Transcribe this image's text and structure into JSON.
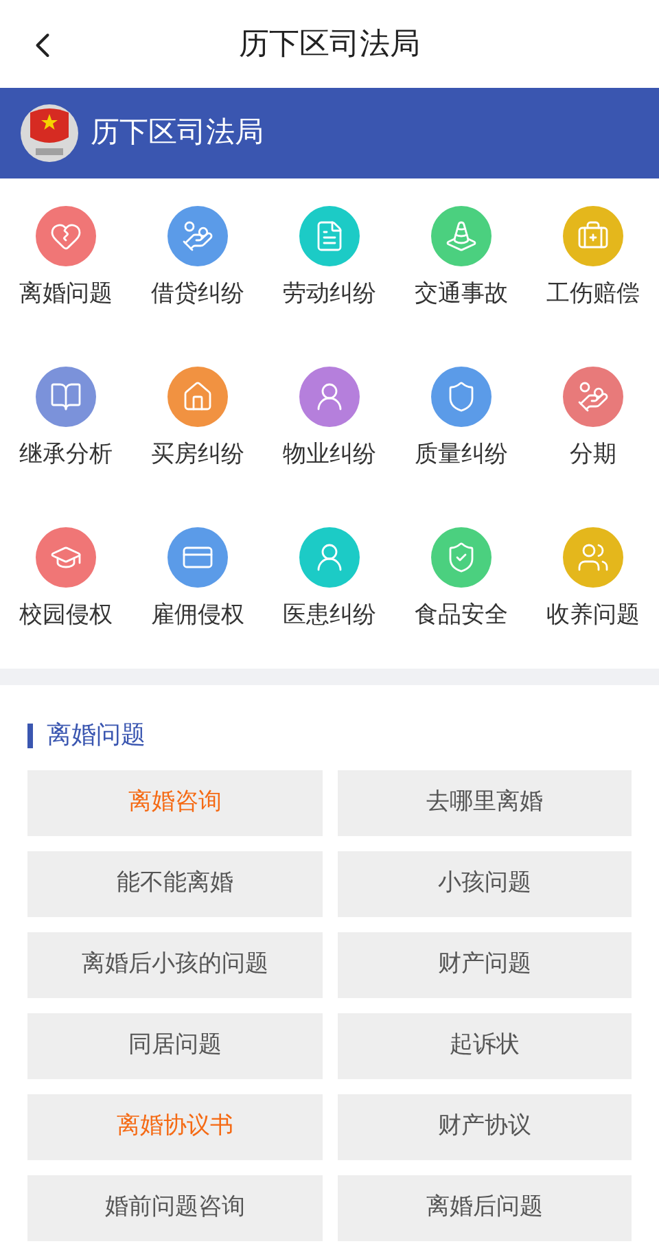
{
  "header": {
    "title": "历下区司法局"
  },
  "banner": {
    "title": "历下区司法局"
  },
  "categories": [
    {
      "label": "离婚问题",
      "color": "#f07676"
    },
    {
      "label": "借贷纠纷",
      "color": "#5b9be8"
    },
    {
      "label": "劳动纠纷",
      "color": "#1ccbc6"
    },
    {
      "label": "交通事故",
      "color": "#4bd07f"
    },
    {
      "label": "工伤赔偿",
      "color": "#e4b71c"
    },
    {
      "label": "继承分析",
      "color": "#7b92da"
    },
    {
      "label": "买房纠纷",
      "color": "#f19241"
    },
    {
      "label": "物业纠纷",
      "color": "#b57fdc"
    },
    {
      "label": "质量纠纷",
      "color": "#5b9be8"
    },
    {
      "label": "分期",
      "color": "#e87a7a"
    },
    {
      "label": "校园侵权",
      "color": "#f07676"
    },
    {
      "label": "雇佣侵权",
      "color": "#5b9be8"
    },
    {
      "label": "医患纠纷",
      "color": "#1ccbc6"
    },
    {
      "label": "食品安全",
      "color": "#4bd07f"
    },
    {
      "label": "收养问题",
      "color": "#e4b71c"
    }
  ],
  "section": {
    "title": "离婚问题",
    "topics": [
      {
        "label": "离婚咨询",
        "selected": true
      },
      {
        "label": "去哪里离婚",
        "selected": false
      },
      {
        "label": "能不能离婚",
        "selected": false
      },
      {
        "label": "小孩问题",
        "selected": false
      },
      {
        "label": "离婚后小孩的问题",
        "selected": false
      },
      {
        "label": "财产问题",
        "selected": false
      },
      {
        "label": "同居问题",
        "selected": false
      },
      {
        "label": "起诉状",
        "selected": false
      },
      {
        "label": "离婚协议书",
        "selected": true
      },
      {
        "label": "财产协议",
        "selected": false
      },
      {
        "label": "婚前问题咨询",
        "selected": false
      },
      {
        "label": "离婚后问题",
        "selected": false
      }
    ]
  }
}
